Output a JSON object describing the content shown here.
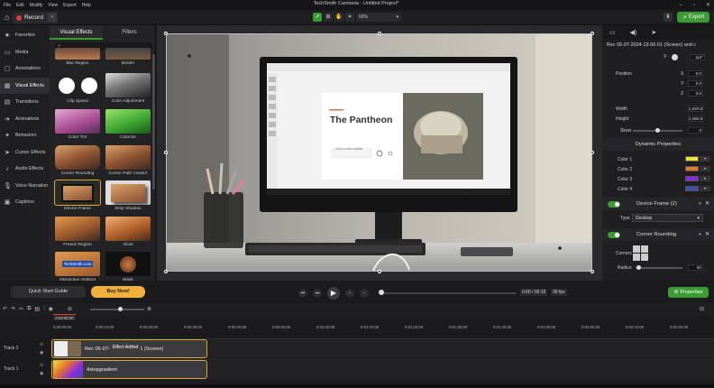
{
  "menu": [
    "File",
    "Edit",
    "Modify",
    "View",
    "Export",
    "Help"
  ],
  "window_title": "TechSmith Camtasia - Untitled Project*",
  "window_controls": [
    "–",
    "▫",
    "✕"
  ],
  "toolbar": {
    "record_label": "Record",
    "zoom": "60%",
    "export_label": "Export",
    "zoom_chevron": "▾"
  },
  "left_nav": [
    {
      "label": "Favorites",
      "icon": "★"
    },
    {
      "label": "Media",
      "icon": "▭"
    },
    {
      "label": "Annotations",
      "icon": "▢"
    },
    {
      "label": "Visual Effects",
      "icon": "▦"
    },
    {
      "label": "Transitions",
      "icon": "▤"
    },
    {
      "label": "Animations",
      "icon": "➜"
    },
    {
      "label": "Behaviors",
      "icon": "✦"
    },
    {
      "label": "Cursor Effects",
      "icon": "➤"
    },
    {
      "label": "Audio Effects",
      "icon": "♪"
    },
    {
      "label": "Voice Narration",
      "icon": "🎙"
    },
    {
      "label": "Captions",
      "icon": "▣"
    }
  ],
  "effects": {
    "tabs": [
      "Visual Effects",
      "Filters"
    ],
    "search_icon": "⌕",
    "tiles": [
      {
        "label": "Blur Region"
      },
      {
        "label": "Border"
      },
      {
        "label": "Clip Speed"
      },
      {
        "label": "Color Adjustment"
      },
      {
        "label": "Color Tint"
      },
      {
        "label": "Colorize"
      },
      {
        "label": "Corner Rounding"
      },
      {
        "label": "Cursor Path Creator"
      },
      {
        "label": "Device Frame"
      },
      {
        "label": "Drop Shadow"
      },
      {
        "label": "Freeze Region"
      },
      {
        "label": "Glow"
      },
      {
        "label": "Interactive Hotspot"
      },
      {
        "label": "Mask"
      }
    ],
    "hotspot_badge": "TechSmith.com"
  },
  "canvas": {
    "slide_title": "The Pantheon",
    "slide_subtitle": "Click to add subtitle"
  },
  "properties": {
    "clip_title": "Rec 05-07-2024-13-56-51 (Screen) and c",
    "scale_value": "112°",
    "position_label": "Position",
    "x": "0.0",
    "y": "0.0",
    "z": "0.0",
    "width_label": "Width",
    "width": "1,920.0",
    "height_label": "Height",
    "height": "1,080.0",
    "skew_label": "Skew",
    "skew": "0",
    "dynamic_title": "Dynamic Properties",
    "colors": [
      {
        "label": "Color 1",
        "hex": "#f2e13a"
      },
      {
        "label": "Color 2",
        "hex": "#e7772b"
      },
      {
        "label": "Color 3",
        "hex": "#8a2be2"
      },
      {
        "label": "Color 4",
        "hex": "#3a4fb0"
      }
    ],
    "device_frame_title": "Device Frame (2)",
    "type_label": "Type",
    "type_value": "Desktop",
    "corner_title": "Corner Rounding",
    "corners_label": "Corners",
    "radius_label": "Radius",
    "radius_value": "50"
  },
  "transport": {
    "quick_start": "Quick Start Guide",
    "buy_now": "Buy Now!",
    "timecode": "0:00 / 00:15",
    "fps": "30 fps",
    "properties_btn": "Properties"
  },
  "timeline": {
    "playhead": "0:00:00;00",
    "ticks": [
      "0:00:00;00",
      "0:00:10;00",
      "0:00:20;00",
      "0:00:30;00",
      "0:00:40;00",
      "0:00:50;00",
      "0:01:00;00",
      "0:01:10;00",
      "0:01:20;00",
      "0:01:30;00",
      "0:01:40;00",
      "0:01:50;00",
      "0:02:00;00",
      "0:02:10;00",
      "0:02:20;00"
    ],
    "tracks": [
      {
        "label": "Track 2",
        "clip": "Rec 05-07-2024-13-56-51 (Screen)"
      },
      {
        "label": "Track 1",
        "clip": "4stopgradient"
      }
    ],
    "tooltip": "Effect Added"
  }
}
